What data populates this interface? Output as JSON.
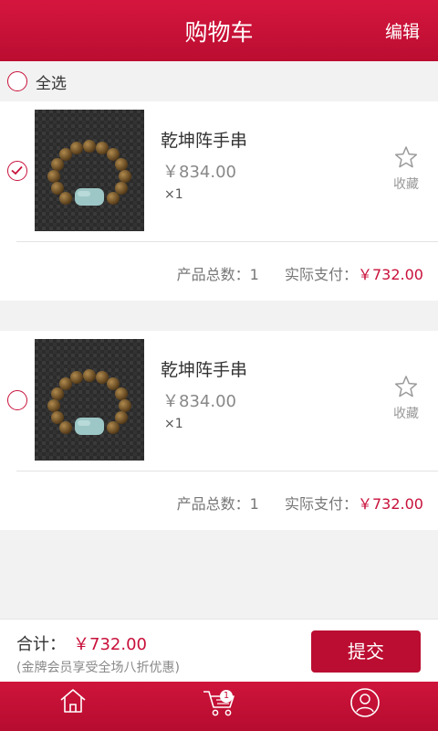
{
  "header": {
    "title": "购物车",
    "edit_label": "编辑"
  },
  "select_all": {
    "label": "全选",
    "checked": false
  },
  "cart_items": [
    {
      "name": "乾坤阵手串",
      "price": "￥834.00",
      "quantity": "×1",
      "favorite_label": "收藏",
      "checked": true,
      "summary_count_label": "产品总数：",
      "summary_count": "1",
      "summary_pay_label": "实际支付：",
      "summary_pay": "￥732.00"
    },
    {
      "name": "乾坤阵手串",
      "price": "￥834.00",
      "quantity": "×1",
      "favorite_label": "收藏",
      "checked": false,
      "summary_count_label": "产品总数：",
      "summary_count": "1",
      "summary_pay_label": "实际支付：",
      "summary_pay": "￥732.00"
    }
  ],
  "bottom": {
    "total_label": "合计：",
    "total_amount": "￥732.00",
    "note": "(金牌会员享受全场八折优惠)",
    "submit_label": "提交"
  },
  "tabbar": {
    "tabs": [
      {
        "icon": "home-icon"
      },
      {
        "icon": "cart-icon",
        "badge": "1"
      },
      {
        "icon": "user-icon"
      }
    ]
  },
  "colors": {
    "brand": "#c8103a",
    "header": "#cf143b",
    "background": "#f2f2f2"
  }
}
